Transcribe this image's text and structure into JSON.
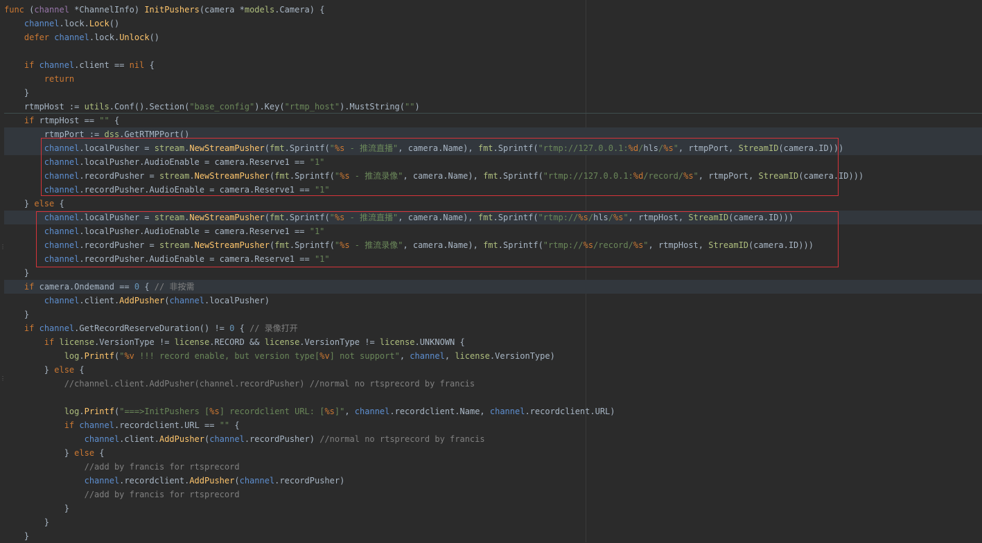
{
  "lines": [
    [
      [
        "kw",
        "func "
      ],
      [
        "plain",
        "("
      ],
      [
        "var",
        "channel "
      ],
      [
        "plain",
        "*"
      ],
      [
        "type",
        "ChannelInfo"
      ],
      [
        "plain",
        ") "
      ],
      [
        "fn",
        "InitPushers"
      ],
      [
        "plain",
        "(camera *"
      ],
      [
        "pkg",
        "models"
      ],
      [
        "plain",
        ".Camera) {"
      ]
    ],
    [
      [
        "plain",
        "    "
      ],
      [
        "recv",
        "channel"
      ],
      [
        "plain",
        ".lock."
      ],
      [
        "call",
        "Lock"
      ],
      [
        "plain",
        "()"
      ]
    ],
    [
      [
        "plain",
        "    "
      ],
      [
        "kw",
        "defer "
      ],
      [
        "recv",
        "channel"
      ],
      [
        "plain",
        ".lock."
      ],
      [
        "call",
        "Unlock"
      ],
      [
        "plain",
        "()"
      ]
    ],
    [],
    [
      [
        "plain",
        "    "
      ],
      [
        "kw",
        "if "
      ],
      [
        "recv",
        "channel"
      ],
      [
        "plain",
        ".client == "
      ],
      [
        "kw",
        "nil "
      ],
      [
        "plain",
        "{"
      ]
    ],
    [
      [
        "plain",
        "        "
      ],
      [
        "kw",
        "return"
      ]
    ],
    [
      [
        "plain",
        "    }"
      ]
    ],
    [
      [
        "plain",
        "    rtmpHost := "
      ],
      [
        "pkg",
        "utils"
      ],
      [
        "plain",
        ".Conf().Section("
      ],
      [
        "str",
        "\"base_config\""
      ],
      [
        "plain",
        ").Key("
      ],
      [
        "str",
        "\"rtmp_host\""
      ],
      [
        "plain",
        ").MustString("
      ],
      [
        "str",
        "\"\""
      ],
      [
        "plain",
        ")"
      ]
    ],
    [
      [
        "plain",
        "    "
      ],
      [
        "kw",
        "if "
      ],
      [
        "plain",
        "rtmpHost == "
      ],
      [
        "str",
        "\"\" "
      ],
      [
        "plain",
        "{"
      ]
    ],
    [
      [
        "plain",
        "        rtmpPort "
      ],
      [
        "sel",
        ":="
      ],
      [
        "plain",
        " "
      ],
      [
        "pkg",
        "dss"
      ],
      [
        "plain",
        ".GetRTMPPort()"
      ]
    ],
    [
      [
        "plain",
        "        "
      ],
      [
        "recv",
        "channel"
      ],
      [
        "plain",
        ".localPusher = "
      ],
      [
        "pkg",
        "stream"
      ],
      [
        "plain",
        "."
      ],
      [
        "call",
        "NewStreamPusher"
      ],
      [
        "plain",
        "("
      ],
      [
        "pkg",
        "fmt"
      ],
      [
        "plain",
        ".Sprintf("
      ],
      [
        "str",
        "\""
      ],
      [
        "fmt",
        "%s"
      ],
      [
        "str",
        " - 推流直播\""
      ],
      [
        "plain",
        ", camera.Name), "
      ],
      [
        "pkg",
        "fmt"
      ],
      [
        "plain",
        ".Sprintf("
      ],
      [
        "str",
        "\"rtmp://127.0.0.1:"
      ],
      [
        "fmt",
        "%d"
      ],
      [
        "str",
        "/"
      ],
      [
        "sel",
        "hls"
      ],
      [
        "str",
        "/"
      ],
      [
        "fmt",
        "%s"
      ],
      [
        "str",
        "\""
      ],
      [
        "plain",
        ", rtmpPort, "
      ],
      [
        "pkg",
        "StreamID"
      ],
      [
        "plain",
        "(camera.ID)))"
      ]
    ],
    [
      [
        "plain",
        "        "
      ],
      [
        "recv",
        "channel"
      ],
      [
        "plain",
        ".localPusher.AudioEnable = camera.Reserve1 == "
      ],
      [
        "str",
        "\"1\""
      ]
    ],
    [
      [
        "plain",
        "        "
      ],
      [
        "recv",
        "channel"
      ],
      [
        "plain",
        ".recordPusher = "
      ],
      [
        "pkg",
        "stream"
      ],
      [
        "plain",
        "."
      ],
      [
        "call",
        "NewStreamPusher"
      ],
      [
        "plain",
        "("
      ],
      [
        "pkg",
        "fmt"
      ],
      [
        "plain",
        ".Sprintf("
      ],
      [
        "str",
        "\""
      ],
      [
        "fmt",
        "%s"
      ],
      [
        "str",
        " - 推流录像\""
      ],
      [
        "plain",
        ", camera.Name), "
      ],
      [
        "pkg",
        "fmt"
      ],
      [
        "plain",
        ".Sprintf("
      ],
      [
        "str",
        "\"rtmp://127.0.0.1:"
      ],
      [
        "fmt",
        "%d"
      ],
      [
        "str",
        "/record/"
      ],
      [
        "fmt",
        "%s"
      ],
      [
        "str",
        "\""
      ],
      [
        "plain",
        ", rtmpPort, "
      ],
      [
        "pkg",
        "StreamID"
      ],
      [
        "plain",
        "(camera.ID)))"
      ]
    ],
    [
      [
        "plain",
        "        "
      ],
      [
        "recv",
        "channel"
      ],
      [
        "plain",
        ".recordPusher.AudioEnable = camera.Reserve1 == "
      ],
      [
        "str",
        "\"1\""
      ]
    ],
    [
      [
        "plain",
        "    } "
      ],
      [
        "kw",
        "else "
      ],
      [
        "plain",
        "{"
      ]
    ],
    [
      [
        "plain",
        "        "
      ],
      [
        "recv",
        "channel"
      ],
      [
        "plain",
        ".localPusher = "
      ],
      [
        "pkg",
        "stream"
      ],
      [
        "plain",
        "."
      ],
      [
        "call",
        "NewStreamPusher"
      ],
      [
        "plain",
        "("
      ],
      [
        "pkg",
        "fmt"
      ],
      [
        "plain",
        ".Sprintf("
      ],
      [
        "str",
        "\""
      ],
      [
        "fmt",
        "%s"
      ],
      [
        "str",
        " - 推流直播\""
      ],
      [
        "plain",
        ", camera.Name), "
      ],
      [
        "pkg",
        "fmt"
      ],
      [
        "plain",
        ".Sprintf("
      ],
      [
        "str",
        "\"rtmp://"
      ],
      [
        "fmt",
        "%s"
      ],
      [
        "str",
        "/"
      ],
      [
        "sel",
        "hls"
      ],
      [
        "str",
        "/"
      ],
      [
        "fmt",
        "%s"
      ],
      [
        "str",
        "\""
      ],
      [
        "plain",
        ", rtmpHost, "
      ],
      [
        "pkg",
        "StreamID"
      ],
      [
        "plain",
        "(camera.ID)))"
      ]
    ],
    [
      [
        "plain",
        "        "
      ],
      [
        "recv",
        "channel"
      ],
      [
        "plain",
        ".localPusher.AudioEnable = camera.Reserve1 == "
      ],
      [
        "str",
        "\"1\""
      ]
    ],
    [
      [
        "plain",
        "        "
      ],
      [
        "recv",
        "channel"
      ],
      [
        "plain",
        ".recordPusher = "
      ],
      [
        "pkg",
        "stream"
      ],
      [
        "plain",
        "."
      ],
      [
        "call",
        "NewStreamPusher"
      ],
      [
        "plain",
        "("
      ],
      [
        "pkg",
        "fmt"
      ],
      [
        "plain",
        ".Sprintf("
      ],
      [
        "str",
        "\""
      ],
      [
        "fmt",
        "%s"
      ],
      [
        "str",
        " - 推流录像\""
      ],
      [
        "plain",
        ", camera.Name), "
      ],
      [
        "pkg",
        "fmt"
      ],
      [
        "plain",
        ".Sprintf("
      ],
      [
        "str",
        "\"rtmp://"
      ],
      [
        "fmt",
        "%s"
      ],
      [
        "str",
        "/record/"
      ],
      [
        "fmt",
        "%s"
      ],
      [
        "str",
        "\""
      ],
      [
        "plain",
        ", rtmpHost, "
      ],
      [
        "pkg",
        "StreamID"
      ],
      [
        "plain",
        "(camera.ID)))"
      ]
    ],
    [
      [
        "plain",
        "        "
      ],
      [
        "recv",
        "channel"
      ],
      [
        "plain",
        ".recordPusher.AudioEnable = camera.Reserve1 == "
      ],
      [
        "str",
        "\"1\""
      ]
    ],
    [
      [
        "plain",
        "    }"
      ]
    ],
    [
      [
        "plain",
        "    "
      ],
      [
        "kw",
        "if "
      ],
      [
        "plain",
        "camera.Ondemand == "
      ],
      [
        "num",
        "0"
      ],
      [
        "plain",
        " { "
      ],
      [
        "com",
        "// 非按需"
      ]
    ],
    [
      [
        "plain",
        "        "
      ],
      [
        "recv",
        "channel"
      ],
      [
        "plain",
        ".client."
      ],
      [
        "call",
        "AddPusher"
      ],
      [
        "plain",
        "("
      ],
      [
        "recv",
        "channel"
      ],
      [
        "plain",
        ".localPusher)"
      ]
    ],
    [
      [
        "plain",
        "    }"
      ]
    ],
    [
      [
        "plain",
        "    "
      ],
      [
        "kw",
        "if "
      ],
      [
        "recv",
        "channel"
      ],
      [
        "plain",
        ".GetRecordReserveDuration() != "
      ],
      [
        "num",
        "0"
      ],
      [
        "plain",
        " { "
      ],
      [
        "com",
        "// 录像打开"
      ]
    ],
    [
      [
        "plain",
        "        "
      ],
      [
        "kw",
        "if "
      ],
      [
        "pkg",
        "license"
      ],
      [
        "plain",
        ".VersionType != "
      ],
      [
        "pkg",
        "license"
      ],
      [
        "plain",
        ".RECORD && "
      ],
      [
        "pkg",
        "license"
      ],
      [
        "plain",
        ".VersionType != "
      ],
      [
        "pkg",
        "license"
      ],
      [
        "plain",
        ".UNKNOWN {"
      ]
    ],
    [
      [
        "plain",
        "            "
      ],
      [
        "pkg",
        "log"
      ],
      [
        "plain",
        "."
      ],
      [
        "call",
        "Printf"
      ],
      [
        "plain",
        "("
      ],
      [
        "str",
        "\""
      ],
      [
        "fmt",
        "%v"
      ],
      [
        "str",
        " !!! record enable, but version type["
      ],
      [
        "fmt",
        "%v"
      ],
      [
        "str",
        "] not support\""
      ],
      [
        "plain",
        ", "
      ],
      [
        "recv",
        "channel"
      ],
      [
        "plain",
        ", "
      ],
      [
        "pkg",
        "license"
      ],
      [
        "plain",
        ".VersionType)"
      ]
    ],
    [
      [
        "plain",
        "        } "
      ],
      [
        "kw",
        "else "
      ],
      [
        "plain",
        "{"
      ]
    ],
    [
      [
        "plain",
        "            "
      ],
      [
        "com",
        "//channel.client.AddPusher(channel.recordPusher) //normal no rtsprecord by francis"
      ]
    ],
    [],
    [
      [
        "plain",
        "            "
      ],
      [
        "pkg",
        "log"
      ],
      [
        "plain",
        "."
      ],
      [
        "call",
        "Printf"
      ],
      [
        "plain",
        "("
      ],
      [
        "str",
        "\"===>InitPushers ["
      ],
      [
        "fmt",
        "%s"
      ],
      [
        "str",
        "] recordclient URL: ["
      ],
      [
        "fmt",
        "%s"
      ],
      [
        "str",
        "]\""
      ],
      [
        "plain",
        ", "
      ],
      [
        "recv",
        "channel"
      ],
      [
        "plain",
        ".recordclient.Name, "
      ],
      [
        "recv",
        "channel"
      ],
      [
        "plain",
        ".recordclient.URL)"
      ]
    ],
    [
      [
        "plain",
        "            "
      ],
      [
        "kw",
        "if "
      ],
      [
        "recv",
        "channel"
      ],
      [
        "plain",
        ".recordclient.URL == "
      ],
      [
        "str",
        "\"\" "
      ],
      [
        "plain",
        "{"
      ]
    ],
    [
      [
        "plain",
        "                "
      ],
      [
        "recv",
        "channel"
      ],
      [
        "plain",
        ".client."
      ],
      [
        "call",
        "AddPusher"
      ],
      [
        "plain",
        "("
      ],
      [
        "recv",
        "channel"
      ],
      [
        "plain",
        ".recordPusher) "
      ],
      [
        "com",
        "//normal no rtsprecord by francis"
      ]
    ],
    [
      [
        "plain",
        "            } "
      ],
      [
        "kw",
        "else "
      ],
      [
        "plain",
        "{"
      ]
    ],
    [
      [
        "plain",
        "                "
      ],
      [
        "com",
        "//add by francis for rtsprecord"
      ]
    ],
    [
      [
        "plain",
        "                "
      ],
      [
        "recv",
        "channel"
      ],
      [
        "plain",
        ".recordclient."
      ],
      [
        "call",
        "AddPusher"
      ],
      [
        "plain",
        "("
      ],
      [
        "recv",
        "channel"
      ],
      [
        "plain",
        ".recordPusher)"
      ]
    ],
    [
      [
        "plain",
        "                "
      ],
      [
        "com",
        "//add by francis for rtsprecord"
      ]
    ],
    [
      [
        "plain",
        "            }"
      ]
    ],
    [
      [
        "plain",
        "        }"
      ]
    ],
    [
      [
        "plain",
        "    }"
      ]
    ]
  ],
  "highlighted_lines": [
    9,
    10,
    15,
    20
  ]
}
